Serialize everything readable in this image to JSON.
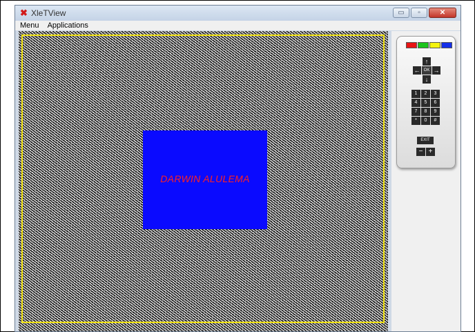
{
  "window": {
    "title": "XleTView",
    "app_icon": "✖",
    "controls": {
      "minimize": "▭",
      "maximize": "▫",
      "close": "✕"
    }
  },
  "menu": {
    "items": [
      "Menu",
      "Applications"
    ]
  },
  "tv": {
    "box_text": "DARWIN ALULEMA"
  },
  "remote": {
    "color_buttons": [
      "#e81414",
      "#1dc41d",
      "#f4f410",
      "#1530e8"
    ],
    "arrows": {
      "up": "↑",
      "down": "↓",
      "left": "←",
      "right": "→"
    },
    "ok_label": "OK",
    "keys": [
      "1",
      "2",
      "3",
      "4",
      "5",
      "6",
      "7",
      "8",
      "9",
      "*",
      "0",
      "#"
    ],
    "exit_label": "EXIT",
    "minus_label": "−",
    "plus_label": "+"
  }
}
